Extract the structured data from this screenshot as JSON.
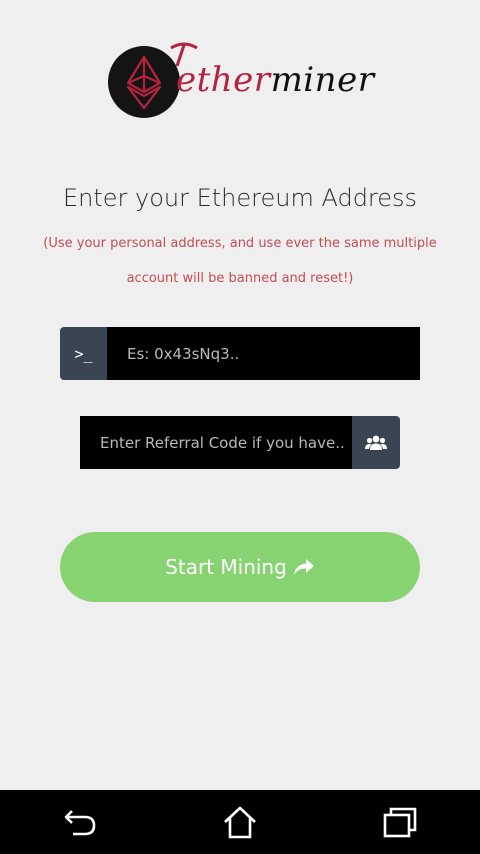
{
  "logo": {
    "word1": "ether",
    "word2": "miner",
    "brand_red": "#b3233f",
    "circle_color": "#141414"
  },
  "form": {
    "headline": "Enter your Ethereum Address",
    "note": "(Use your personal address, and use ever the same multiple account will be banned and reset!)",
    "address_prefix": ">_",
    "address_placeholder": "Es: 0x43sNq3..",
    "referral_placeholder": "Enter Referral Code if you have..",
    "referral_icon": "users-icon",
    "start_label": "Start Mining",
    "start_icon": "share-arrow-icon",
    "accent_green": "#87d271",
    "addon_color": "#3a4553"
  },
  "navbar": {
    "items": [
      "back-icon",
      "home-icon",
      "recent-apps-icon"
    ]
  }
}
